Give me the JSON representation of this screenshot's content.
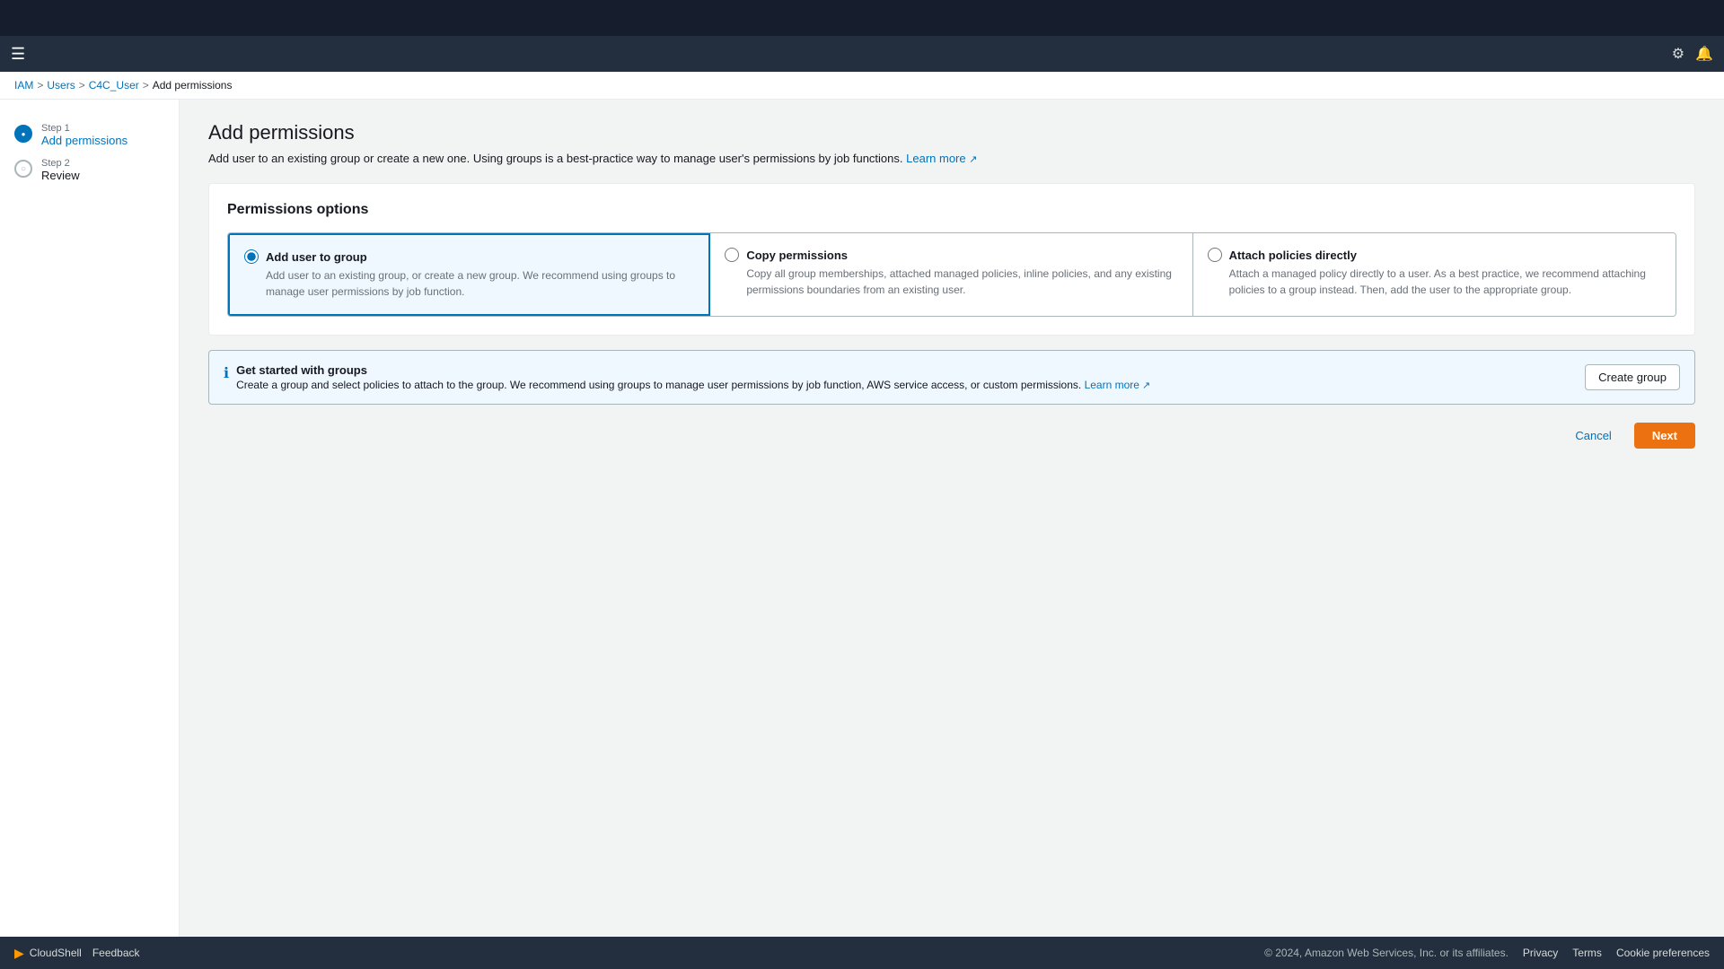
{
  "topBar": {},
  "navBar": {
    "hamburgerIcon": "☰",
    "settingsIcon": "⚙",
    "bellIcon": "🔔"
  },
  "breadcrumb": {
    "iam": "IAM",
    "users": "Users",
    "user": "C4C_User",
    "current": "Add permissions",
    "sep": ">"
  },
  "sidebar": {
    "step1": {
      "number": "Step 1",
      "name": "Add permissions",
      "state": "active"
    },
    "step2": {
      "number": "Step 2",
      "name": "Review",
      "state": "inactive"
    }
  },
  "page": {
    "title": "Add permissions",
    "description": "Add user to an existing group or create a new one. Using groups is a best-practice way to manage user's permissions by job functions.",
    "learnMoreText": "Learn more",
    "learnMoreIcon": "↗"
  },
  "permissionsOptions": {
    "sectionTitle": "Permissions options",
    "options": [
      {
        "id": "add-user-to-group",
        "label": "Add user to group",
        "description": "Add user to an existing group, or create a new group. We recommend using groups to manage user permissions by job function.",
        "selected": true
      },
      {
        "id": "copy-permissions",
        "label": "Copy permissions",
        "description": "Copy all group memberships, attached managed policies, inline policies, and any existing permissions boundaries from an existing user.",
        "selected": false
      },
      {
        "id": "attach-policies",
        "label": "Attach policies directly",
        "description": "Attach a managed policy directly to a user. As a best practice, we recommend attaching policies to a group instead. Then, add the user to the appropriate group.",
        "selected": false
      }
    ]
  },
  "getStarted": {
    "infoIcon": "ℹ",
    "title": "Get started with groups",
    "description": "Create a group and select policies to attach to the group. We recommend using groups to manage user permissions by job function, AWS service access, or custom permissions.",
    "learnMoreText": "Learn more",
    "learnMoreIcon": "↗",
    "createGroupBtn": "Create group"
  },
  "actions": {
    "cancelBtn": "Cancel",
    "nextBtn": "Next"
  },
  "footer": {
    "cloudShellIcon": "▶",
    "cloudShellLabel": "CloudShell",
    "feedbackLabel": "Feedback",
    "copyright": "© 2024, Amazon Web Services, Inc. or its affiliates.",
    "privacyLabel": "Privacy",
    "termsLabel": "Terms",
    "cookieLabel": "Cookie preferences"
  }
}
